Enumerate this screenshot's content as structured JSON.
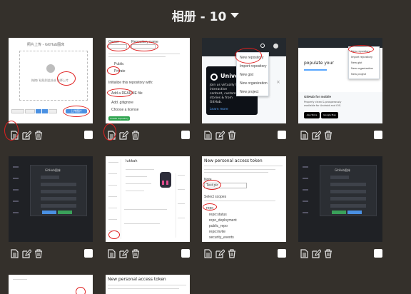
{
  "album": {
    "title": "相册 - 10"
  },
  "cards": [
    {
      "id": 1,
      "upload_title": "照片上传 - GitHub图床",
      "drop_hint": "拖拽/ 粘贴到此处或 选择上传",
      "upload_button": "上传图片"
    },
    {
      "id": 2,
      "labels": [
        "Owner",
        "Repository name",
        "Public",
        "Private",
        "Initialize this repository with:",
        "Add a README file",
        "Add .gitignore",
        "Choose a license",
        "Create repository"
      ]
    },
    {
      "id": 3,
      "menu": [
        "New repository",
        "Import repository",
        "New gist",
        "New organization",
        "New project"
      ],
      "hero_title": "Universe",
      "hero_body": "Join us virtually for interactive content, customer stories & from GitHub.",
      "hero_link": "Learn more"
    },
    {
      "id": 4,
      "menu": [
        "New repository",
        "Import repository",
        "New gist",
        "New organization",
        "New project"
      ],
      "side_text": "populate your",
      "mobile_title": "GitHub for mobile",
      "mobile_body": "Properly clean & prosperously available for Android and iOS.",
      "store_buttons": [
        "App Store",
        "Google Play"
      ]
    },
    {
      "id": 5,
      "panel_title": "GitHub图床"
    },
    {
      "id": 6,
      "profile_name": "lukkah"
    },
    {
      "id": 7,
      "page_title": "New personal access token",
      "note_label": "Note",
      "note_value": "Test pic",
      "scopes_label": "Select scopes",
      "scope_items": [
        "repo",
        "repo:status",
        "repo_deployment",
        "public_repo",
        "repo:invite",
        "security_events"
      ]
    },
    {
      "id": 8,
      "panel_title": "GitHub图床"
    },
    {
      "id": 9
    },
    {
      "id": 10,
      "page_title": "New personal access token"
    }
  ],
  "colors": {
    "background": "#34302b",
    "highlight": "#e02020",
    "accent_blue": "#4a90e2"
  }
}
